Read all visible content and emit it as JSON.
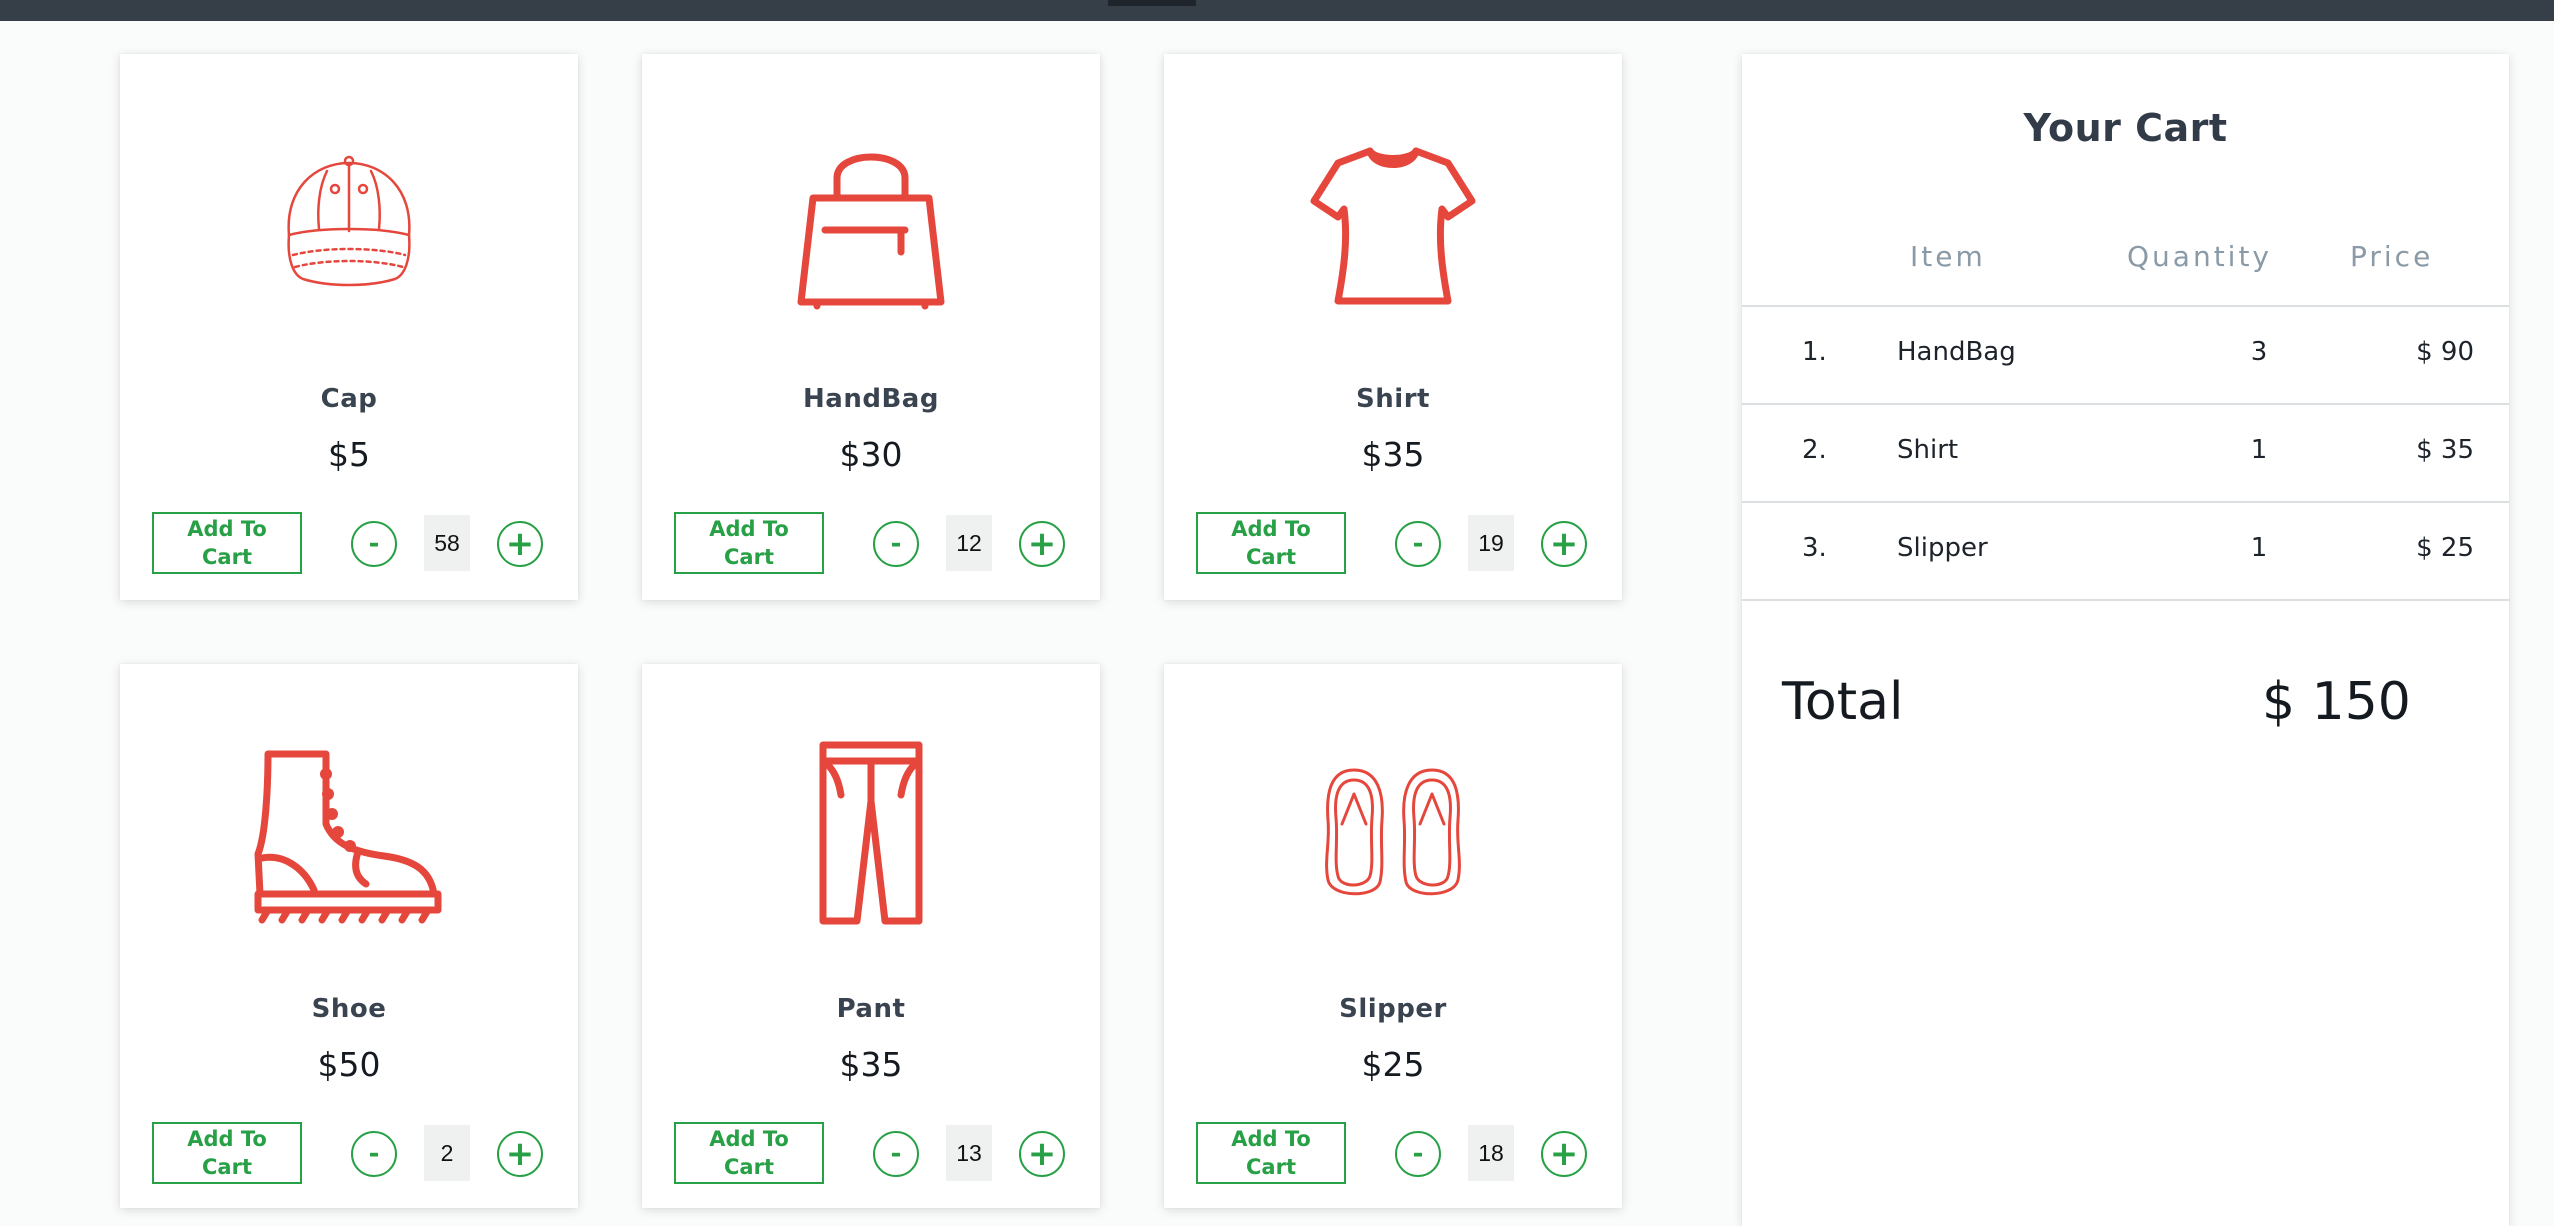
{
  "products": [
    {
      "name": "Cap",
      "price": "$5",
      "add_label": "Add To Cart",
      "quantity": "58",
      "icon": "cap-icon"
    },
    {
      "name": "HandBag",
      "price": "$30",
      "add_label": "Add To Cart",
      "quantity": "12",
      "icon": "handbag-icon"
    },
    {
      "name": "Shirt",
      "price": "$35",
      "add_label": "Add To Cart",
      "quantity": "19",
      "icon": "shirt-icon"
    },
    {
      "name": "Shoe",
      "price": "$50",
      "add_label": "Add To Cart",
      "quantity": "2",
      "icon": "boot-icon"
    },
    {
      "name": "Pant",
      "price": "$35",
      "add_label": "Add To Cart",
      "quantity": "13",
      "icon": "pants-icon"
    },
    {
      "name": "Slipper",
      "price": "$25",
      "add_label": "Add To Cart",
      "quantity": "18",
      "icon": "slippers-icon"
    }
  ],
  "stepper": {
    "minus_label": "-",
    "plus_label": "+"
  },
  "cart": {
    "title": "Your Cart",
    "headers": {
      "item": "Item",
      "quantity": "Quantity",
      "price": "Price"
    },
    "rows": [
      {
        "index": "1.",
        "item": "HandBag",
        "quantity": "3",
        "price": "$ 90"
      },
      {
        "index": "2.",
        "item": "Shirt",
        "quantity": "1",
        "price": "$ 35"
      },
      {
        "index": "3.",
        "item": "Slipper",
        "quantity": "1",
        "price": "$ 25"
      }
    ],
    "total_label": "Total",
    "total_value": "$ 150"
  },
  "colors": {
    "icon": "#e5473c",
    "accent": "#27a046",
    "topbar": "#363e48"
  }
}
